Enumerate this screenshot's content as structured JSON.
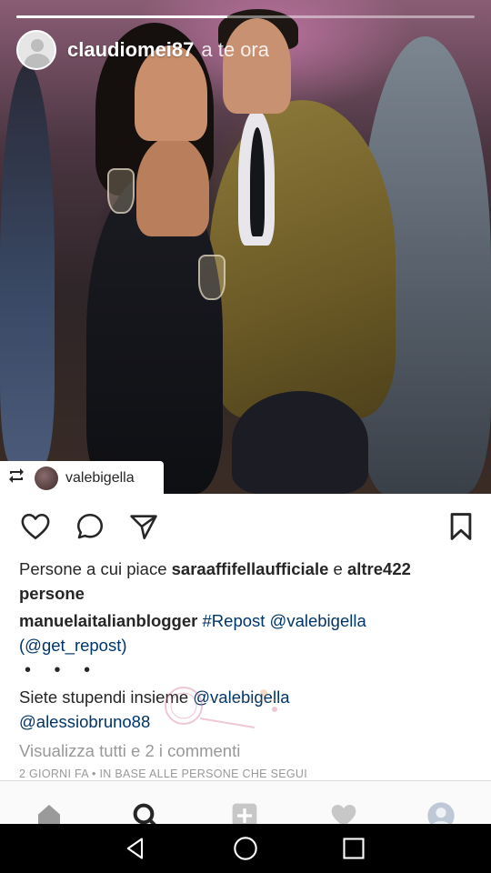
{
  "story": {
    "progress_fraction": 0.46,
    "username": "claudiomei87",
    "time": "a te ora"
  },
  "repost_tag": {
    "username": "valebigella"
  },
  "post": {
    "likes": {
      "prefix": "Persone a cui piace",
      "user": "saraaffifellaufficiale",
      "conj": "e",
      "others": "altre422 persone"
    },
    "caption": {
      "author": "manuelaitalianblogger",
      "hashtag": "#Repost",
      "mention": "@valebigella",
      "source": "(@get_repost)",
      "dots": "• • •"
    },
    "comment": {
      "text": "Siete stupendi insieme",
      "mention1": "@valebigella",
      "mention2": "@alessiobruno88"
    },
    "view_all": "Visualizza tutti e 2 i commenti",
    "date": "2 GIORNI FA • IN BASE ALLE PERSONE CHE SEGUI"
  },
  "icons": {
    "like": "heart-outline-icon",
    "comment": "comment-bubble-icon",
    "share": "paper-plane-icon",
    "save": "bookmark-icon",
    "repost": "repost-arrows-icon"
  },
  "tabs": [
    "home",
    "search",
    "add",
    "activity",
    "profile"
  ],
  "colors": {
    "link": "#003569",
    "text": "#262626",
    "muted": "#999999"
  }
}
